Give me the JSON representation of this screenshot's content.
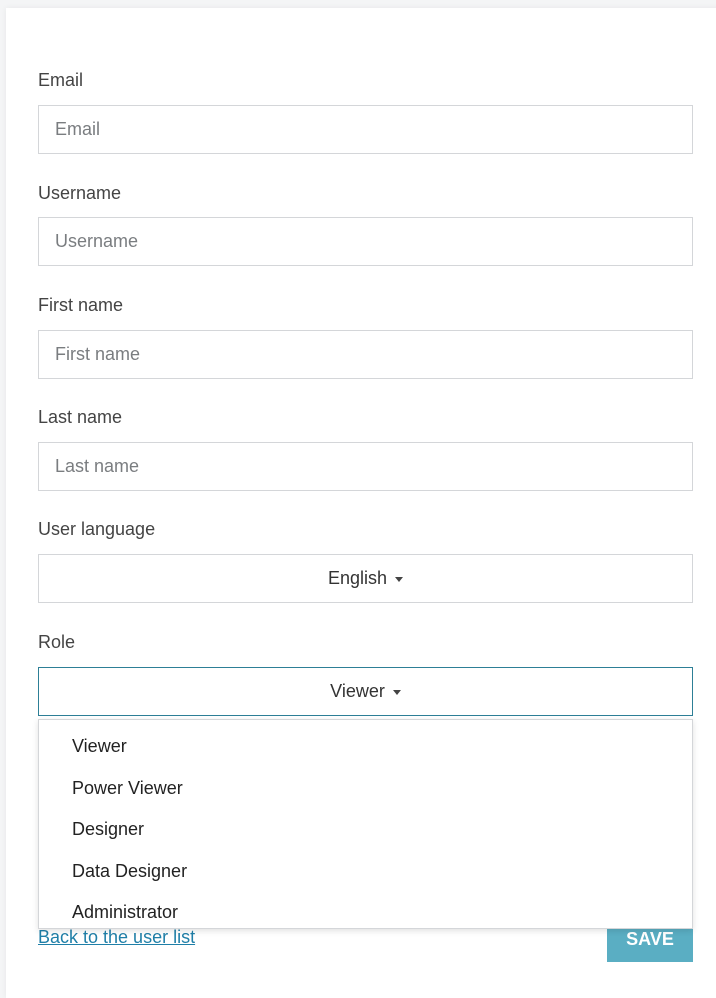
{
  "form": {
    "email": {
      "label": "Email",
      "value": "",
      "placeholder": "Email"
    },
    "username": {
      "label": "Username",
      "value": "",
      "placeholder": "Username"
    },
    "first_name": {
      "label": "First name",
      "value": "",
      "placeholder": "First name"
    },
    "last_name": {
      "label": "Last name",
      "value": "",
      "placeholder": "Last name"
    },
    "user_language": {
      "label": "User language",
      "selected": "English"
    },
    "role": {
      "label": "Role",
      "selected": "Viewer",
      "options": [
        "Viewer",
        "Power Viewer",
        "Designer",
        "Data Designer",
        "Administrator"
      ]
    }
  },
  "footer": {
    "back_link": "Back to the user list",
    "save_label": "SAVE"
  },
  "colors": {
    "accent": "#2d7f96",
    "save_button": "#5aaec3",
    "link": "#1f7fa8",
    "partially_hidden_indicator": "#e0876a"
  }
}
